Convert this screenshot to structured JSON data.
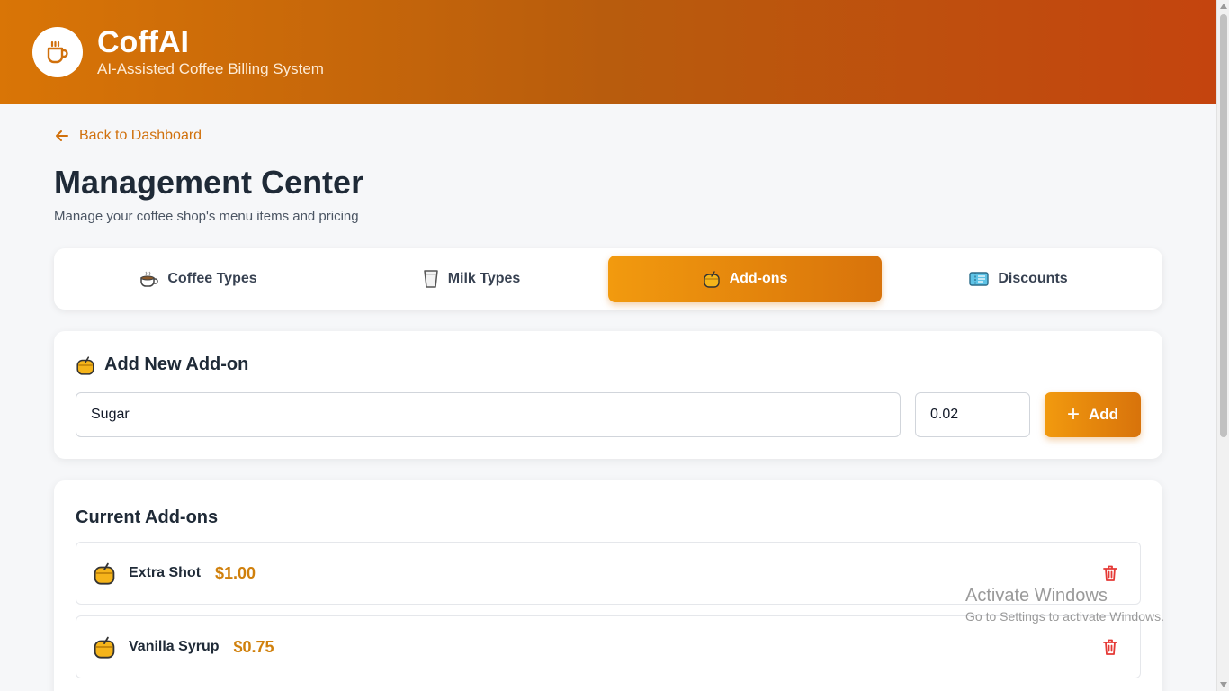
{
  "header": {
    "title": "CoffAI",
    "subtitle": "AI-Assisted Coffee Billing System",
    "logo_icon": "coffee-cup-icon",
    "gradient": [
      "#d97506",
      "#c4440e"
    ]
  },
  "nav": {
    "back_label": "Back to Dashboard"
  },
  "page": {
    "title": "Management Center",
    "subtitle": "Manage your coffee shop's menu items and pricing"
  },
  "tabs": [
    {
      "label": "Coffee Types",
      "icon": "coffee-icon",
      "active": false
    },
    {
      "label": "Milk Types",
      "icon": "milk-glass-icon",
      "active": false
    },
    {
      "label": "Add-ons",
      "icon": "honey-pot-icon",
      "active": true
    },
    {
      "label": "Discounts",
      "icon": "ticket-icon",
      "active": false
    }
  ],
  "add_form": {
    "title": "Add New Add-on",
    "icon": "honey-pot-icon",
    "name_value": "Sugar",
    "price_value": "0.02",
    "add_label": "Add"
  },
  "list": {
    "title": "Current Add-ons",
    "items": [
      {
        "name": "Extra Shot",
        "price": "$1.00",
        "icon": "honey-pot-icon"
      },
      {
        "name": "Vanilla Syrup",
        "price": "$0.75",
        "icon": "honey-pot-icon"
      }
    ]
  },
  "watermark": {
    "line1": "Activate Windows",
    "line2": "Go to Settings to activate Windows."
  },
  "colors": {
    "accent": "#e58a0c",
    "price": "#d0800c",
    "delete": "#e53935"
  }
}
